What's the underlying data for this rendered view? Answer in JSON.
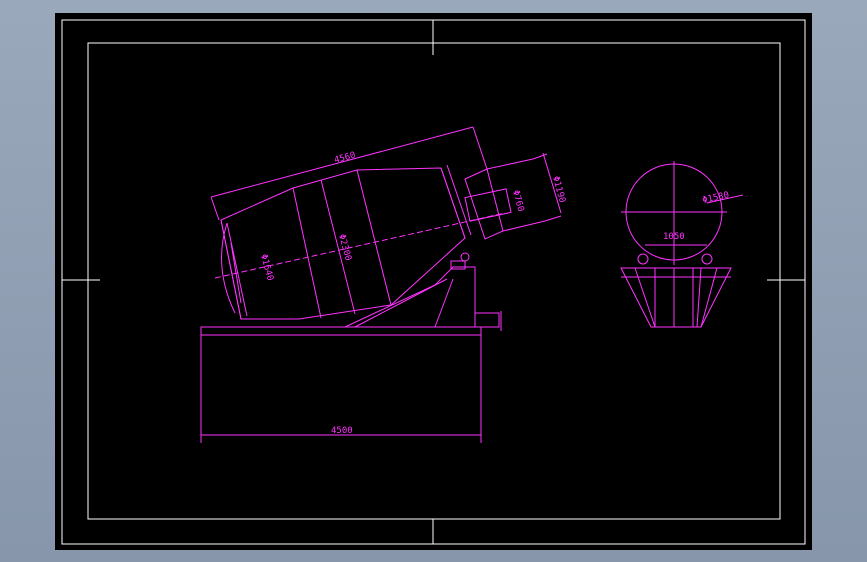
{
  "colors": {
    "background": "#000000",
    "frame": "#ffffff",
    "geometry": "#ff33ff",
    "window": "#8f9db1"
  },
  "dimensions": {
    "drum_length": "4560",
    "drum_mid_diameter": "Φ2300",
    "drum_end_diameter": "Φ1640",
    "outlet_diameter": "Φ760",
    "outlet_flange": "Φ1190",
    "base_length": "4500",
    "end_view_diameter": "Φ1580",
    "support_spacing": "1050"
  }
}
